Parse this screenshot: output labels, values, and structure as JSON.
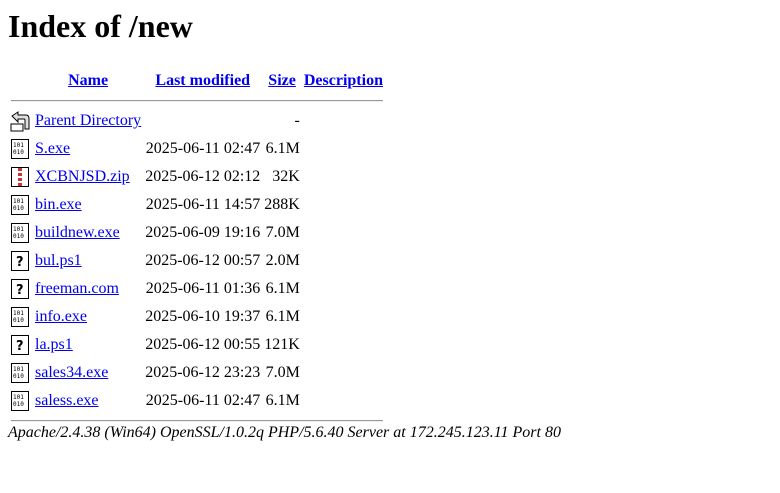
{
  "page": {
    "title": "Index of /new"
  },
  "columns": {
    "name": "Name",
    "last_modified": "Last modified",
    "size": "Size",
    "description": "Description"
  },
  "parent": {
    "label": "Parent Directory",
    "size": "-",
    "icon": "back-icon"
  },
  "files": [
    {
      "name": "S.exe",
      "modified": "2025-06-11 02:47",
      "size": "6.1M",
      "icon": "binary-icon"
    },
    {
      "name": "XCBNJSD.zip",
      "modified": "2025-06-12 02:12",
      "size": "32K",
      "icon": "compressed-icon"
    },
    {
      "name": "bin.exe",
      "modified": "2025-06-11 14:57",
      "size": "288K",
      "icon": "binary-icon"
    },
    {
      "name": "buildnew.exe",
      "modified": "2025-06-09 19:16",
      "size": "7.0M",
      "icon": "binary-icon"
    },
    {
      "name": "bul.ps1",
      "modified": "2025-06-12 00:57",
      "size": "2.0M",
      "icon": "unknown-file-icon"
    },
    {
      "name": "freeman.com",
      "modified": "2025-06-11 01:36",
      "size": "6.1M",
      "icon": "unknown-file-icon"
    },
    {
      "name": "info.exe",
      "modified": "2025-06-10 19:37",
      "size": "6.1M",
      "icon": "binary-icon"
    },
    {
      "name": "la.ps1",
      "modified": "2025-06-12 00:55",
      "size": "121K",
      "icon": "unknown-file-icon"
    },
    {
      "name": "sales34.exe",
      "modified": "2025-06-12 23:23",
      "size": "7.0M",
      "icon": "binary-icon"
    },
    {
      "name": "saless.exe",
      "modified": "2025-06-11 02:47",
      "size": "6.1M",
      "icon": "binary-icon"
    }
  ],
  "footer": {
    "signature": "Apache/2.4.38 (Win64) OpenSSL/1.0.2q PHP/5.6.40 Server at 172.245.123.11 Port 80"
  },
  "colors": {
    "link": "#0000ee"
  }
}
